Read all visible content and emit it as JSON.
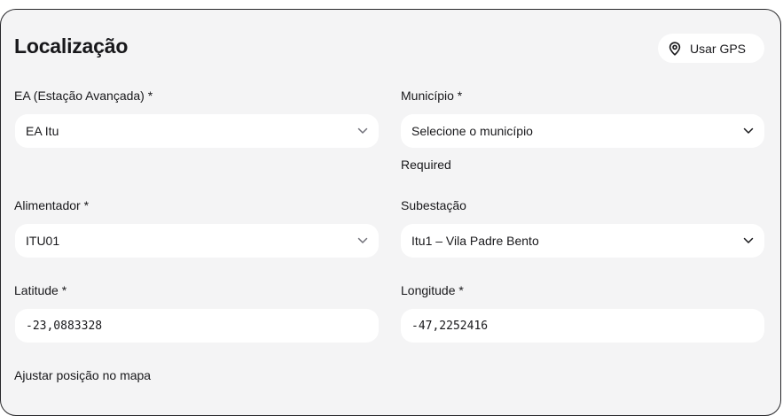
{
  "section": {
    "title": "Localização",
    "gps_button": "Usar GPS",
    "gps_icon": "map-pin-icon"
  },
  "fields": {
    "ea": {
      "label": "EA (Estação Avançada) *",
      "value": "EA Itu"
    },
    "municipio": {
      "label": "Município *",
      "value": "Selecione o município",
      "hint": "Required"
    },
    "alimentador": {
      "label": "Alimentador *",
      "value": "ITU01"
    },
    "subestacao": {
      "label": "Subestação",
      "value": "Itu1 – Vila Padre Bento"
    },
    "latitude": {
      "label": "Latitude *",
      "value": "-23,0883328"
    },
    "longitude": {
      "label": "Longitude *",
      "value": "-47,2252416"
    }
  },
  "map": {
    "label": "Ajustar posição no mapa"
  },
  "icons": {
    "select": "chevron-down-icon"
  }
}
